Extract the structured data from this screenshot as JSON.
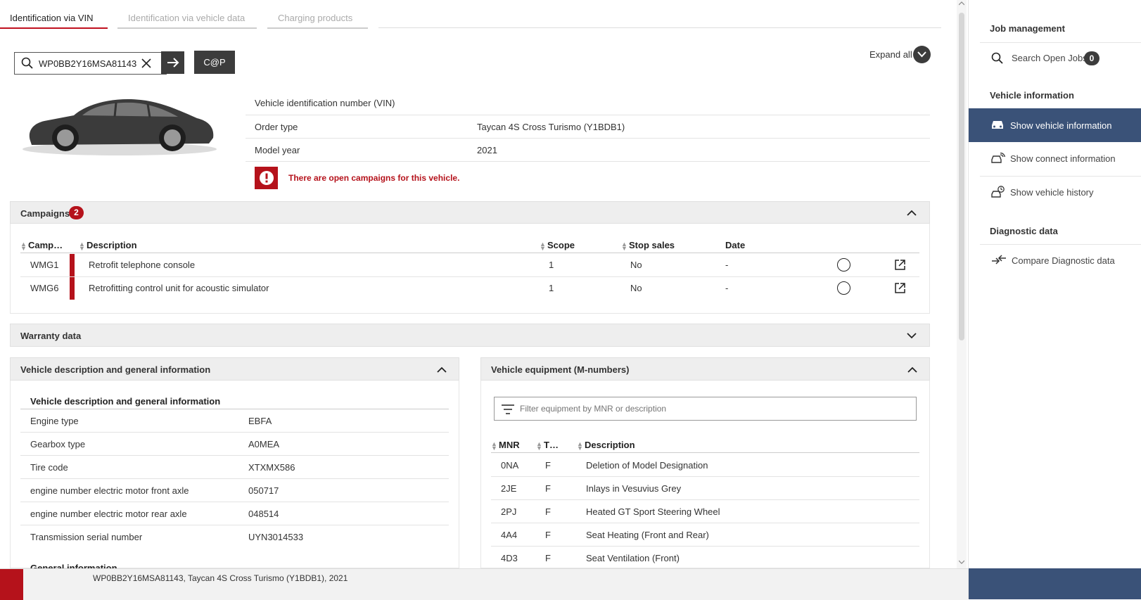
{
  "tabs": [
    {
      "label": "Identification via VIN"
    },
    {
      "label": "Identification via vehicle data"
    },
    {
      "label": "Charging products"
    }
  ],
  "search": {
    "value": "WP0BB2Y16MSA81143",
    "cap_label": "C@P"
  },
  "expand_all": "Expand all",
  "vehicle": {
    "rows": [
      {
        "label": "Vehicle identification number (VIN)",
        "value": ""
      },
      {
        "label": "Order type",
        "value": "Taycan 4S Cross Turismo (Y1BDB1)"
      },
      {
        "label": "Model year",
        "value": "2021"
      }
    ],
    "alert": "There are open campaigns for this vehicle."
  },
  "campaigns": {
    "title": "Campaigns",
    "count": "2",
    "columns": [
      "Camp…",
      "Description",
      "Scope",
      "Stop sales",
      "Date"
    ],
    "rows": [
      {
        "code": "WMG1",
        "description": "Retrofit telephone console",
        "scope": "1",
        "stop_sales": "No",
        "date": "-"
      },
      {
        "code": "WMG6",
        "description": "Retrofitting control unit for acoustic simulator",
        "scope": "1",
        "stop_sales": "No",
        "date": "-"
      }
    ]
  },
  "warranty": {
    "title": "Warranty data"
  },
  "vehicle_description": {
    "title": "Vehicle description and general information",
    "subtitle": "Vehicle description and general information",
    "rows": [
      {
        "label": "Engine type",
        "value": "EBFA"
      },
      {
        "label": "Gearbox type",
        "value": "A0MEA"
      },
      {
        "label": "Tire code",
        "value": "XTXMX586"
      },
      {
        "label": "engine number electric motor front axle",
        "value": "050717"
      },
      {
        "label": "engine number electric motor rear axle",
        "value": "048514"
      },
      {
        "label": "Transmission serial number",
        "value": "UYN3014533"
      }
    ],
    "next_section": "General information"
  },
  "equipment": {
    "title": "Vehicle equipment (M-numbers)",
    "filter_placeholder": "Filter equipment by MNR or description",
    "columns": [
      "MNR",
      "T…",
      "Description"
    ],
    "rows": [
      {
        "mnr": "0NA",
        "type": "F",
        "description": "Deletion of Model Designation"
      },
      {
        "mnr": "2JE",
        "type": "F",
        "description": "Inlays in Vesuvius Grey"
      },
      {
        "mnr": "2PJ",
        "type": "F",
        "description": "Heated GT Sport Steering Wheel"
      },
      {
        "mnr": "4A4",
        "type": "F",
        "description": "Seat Heating (Front and Rear)"
      },
      {
        "mnr": "4D3",
        "type": "F",
        "description": "Seat Ventilation (Front)"
      }
    ]
  },
  "sidebar": {
    "job_management": "Job management",
    "search_open_jobs": "Search Open Jobs",
    "open_jobs_count": "0",
    "vehicle_information": "Vehicle information",
    "items": [
      {
        "label": "Show vehicle information"
      },
      {
        "label": "Show connect information"
      },
      {
        "label": "Show vehicle history"
      }
    ],
    "diagnostic_data": "Diagnostic data",
    "compare_diagnostic": "Compare Diagnostic data"
  },
  "footer": {
    "summary": "WP0BB2Y16MSA81143, Taycan 4S Cross Turismo (Y1BDB1), 2021"
  },
  "colors": {
    "accent_red": "#b5121b",
    "selected_blue": "#3a5278",
    "dark_button": "#3c3c3c"
  }
}
